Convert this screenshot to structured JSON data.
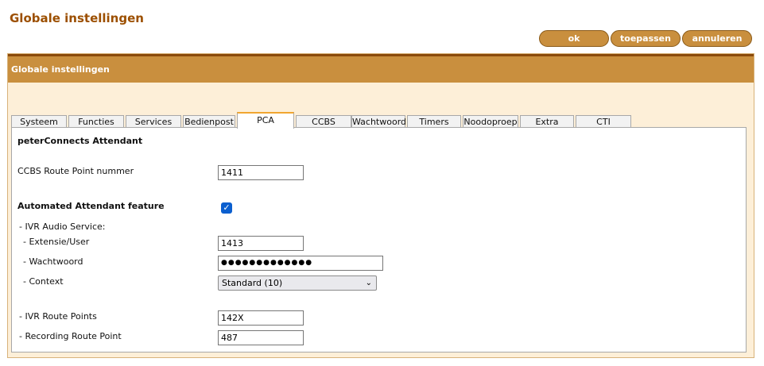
{
  "header": {
    "title": "Globale instellingen"
  },
  "toolbar": {
    "ok_label": "ok",
    "apply_label": "toepassen",
    "cancel_label": "annuleren"
  },
  "panel": {
    "title": "Globale instellingen"
  },
  "tabs": [
    {
      "label": "Systeem"
    },
    {
      "label": "Functies"
    },
    {
      "label": "Services"
    },
    {
      "label": "Bedienpost"
    },
    {
      "label": "PCA",
      "active": true
    },
    {
      "label": "CCBS"
    },
    {
      "label": "Wachtwoord"
    },
    {
      "label": "Timers"
    },
    {
      "label": "Noodoproep"
    },
    {
      "label": "Extra"
    },
    {
      "label": "CTI"
    }
  ],
  "form": {
    "section_title": "peterConnects Attendant",
    "ccbs_route_point": {
      "label": "CCBS Route Point nummer",
      "value": "1411"
    },
    "automated_attendant": {
      "label": "Automated Attendant feature",
      "checked": true,
      "check_glyph": "✓"
    },
    "ivr_audio_service": {
      "label": "- IVR Audio Service:"
    },
    "extension": {
      "label": "- Extensie/User",
      "value": "1413"
    },
    "password": {
      "label": "- Wachtwoord",
      "value": "●●●●●●●●●●●●●"
    },
    "context": {
      "label": "- Context",
      "value": "Standard (10)",
      "chevron": "⌄"
    },
    "ivr_route_points": {
      "label": "- IVR Route Points",
      "value": "142X"
    },
    "recording_route_point": {
      "label": "- Recording Route Point",
      "value": "487"
    }
  },
  "colors": {
    "title": "#9c4f00",
    "accent": "#c98f3e",
    "panel_bg": "#fdefd8",
    "active_tab": "#f1a630",
    "checkbox": "#0b5fcf"
  }
}
